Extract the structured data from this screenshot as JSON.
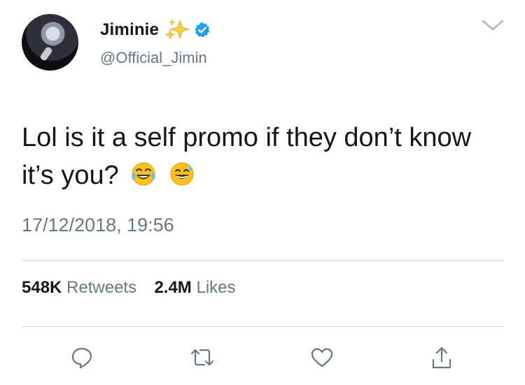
{
  "tweet": {
    "display_name": "Jiminie",
    "handle": "@Official_Jimin",
    "text": "Lol is it a self promo if they don’t know it’s you?",
    "emojis": [
      "face-with-tears-of-joy",
      "grinning-face-with-sweat"
    ],
    "timestamp": "17/12/2018, 19:56",
    "retweets_count": "548K",
    "retweets_label": "Retweets",
    "likes_count": "2.4M",
    "likes_label": "Likes"
  },
  "icons": {
    "name_decoration": "sparkles-icon",
    "verified": "verified-badge-icon",
    "menu": "chevron-down-icon",
    "reply": "reply-icon",
    "retweet": "retweet-icon",
    "like": "heart-icon",
    "share": "share-icon"
  },
  "colors": {
    "text_primary": "#14171a",
    "text_secondary": "#657786",
    "verified_blue": "#1da1f2",
    "divider": "#d6dbe0"
  }
}
